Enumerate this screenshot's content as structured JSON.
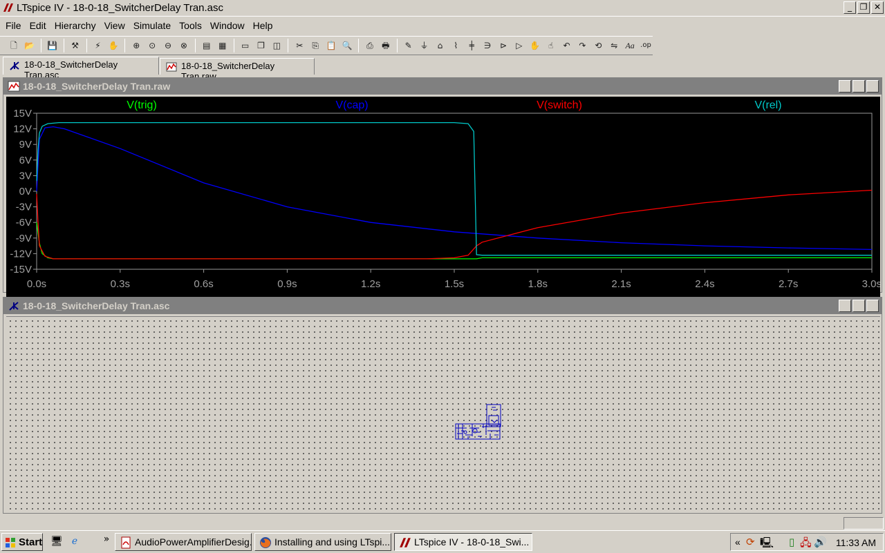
{
  "window": {
    "title": "LTspice IV - 18-0-18_SwitcherDelay Tran.asc"
  },
  "menu": [
    "File",
    "Edit",
    "Hierarchy",
    "View",
    "Simulate",
    "Tools",
    "Window",
    "Help"
  ],
  "toolbar_icons": [
    "new-schematic-icon",
    "open-icon",
    "save-icon",
    "control-panel-icon",
    "run-icon",
    "halt-icon",
    "zoom-in-icon",
    "pan-icon",
    "zoom-out-icon",
    "zoom-fit-icon",
    "autorange-icon",
    "grid-icon",
    "tile-horizontal-icon",
    "cascade-icon",
    "tile-vertical-icon",
    "cut-icon",
    "copy-icon",
    "paste-icon",
    "find-icon",
    "print-setup-icon",
    "print-icon",
    "draw-wire-icon",
    "ground-icon",
    "label-icon",
    "resistor-icon",
    "capacitor-icon",
    "inductor-icon",
    "diode-icon",
    "component-icon",
    "move-icon",
    "drag-icon",
    "undo-icon",
    "redo-icon",
    "rotate-icon",
    "mirror-icon",
    "text-icon",
    "spice-directive-icon"
  ],
  "tabs": [
    {
      "label": "18-0-18_SwitcherDelay Tran.asc",
      "active": true
    },
    {
      "label": "18-0-18_SwitcherDelay Tran.raw",
      "active": false
    }
  ],
  "waveform_window": {
    "title": "18-0-18_SwitcherDelay Tran.raw"
  },
  "schematic_window": {
    "title": "18-0-18_SwitcherDelay Tran.asc"
  },
  "chart_data": {
    "type": "line",
    "xlabel": "",
    "ylabel": "",
    "xlim": [
      0,
      3.0
    ],
    "ylim": [
      -15,
      15
    ],
    "x_ticks": [
      "0.0s",
      "0.3s",
      "0.6s",
      "0.9s",
      "1.2s",
      "1.5s",
      "1.8s",
      "2.1s",
      "2.4s",
      "2.7s",
      "3.0s"
    ],
    "y_ticks": [
      "15V",
      "12V",
      "9V",
      "6V",
      "3V",
      "0V",
      "-3V",
      "-6V",
      "-9V",
      "-12V",
      "-15V"
    ],
    "grid": false,
    "series": [
      {
        "name": "V(trig)",
        "color": "#00ff00",
        "x": [
          0,
          0.01,
          0.02,
          0.04,
          0.06,
          0.1,
          0.5,
          1.0,
          1.5,
          1.55,
          1.58,
          1.6,
          2.0,
          2.5,
          3.0
        ],
        "y": [
          -6,
          -10,
          -12,
          -12.8,
          -13,
          -13,
          -13,
          -13,
          -13,
          -13,
          -13,
          -12.8,
          -12.8,
          -12.8,
          -12.8
        ]
      },
      {
        "name": "V(cap)",
        "color": "#0000ff",
        "x": [
          0,
          0.01,
          0.03,
          0.06,
          0.1,
          0.3,
          0.6,
          0.9,
          1.2,
          1.5,
          1.8,
          2.1,
          2.4,
          2.7,
          3.0
        ],
        "y": [
          0,
          10,
          12.2,
          12.4,
          12,
          8.2,
          1.6,
          -3.0,
          -6.0,
          -7.8,
          -9.0,
          -9.9,
          -10.5,
          -10.9,
          -11.2
        ]
      },
      {
        "name": "V(switch)",
        "color": "#ff0000",
        "x": [
          0,
          0.005,
          0.01,
          0.03,
          0.06,
          0.1,
          0.5,
          1.0,
          1.4,
          1.5,
          1.55,
          1.58,
          1.6,
          1.8,
          2.1,
          2.4,
          2.7,
          3.0
        ],
        "y": [
          -0.5,
          -6,
          -10.5,
          -12.5,
          -13,
          -13,
          -13,
          -13,
          -13,
          -12.8,
          -12.3,
          -10.5,
          -9.8,
          -7.0,
          -4.2,
          -2.2,
          -0.7,
          0.2
        ]
      },
      {
        "name": "V(rel)",
        "color": "#00c8c8",
        "x": [
          0,
          0.005,
          0.01,
          0.02,
          0.04,
          0.08,
          0.5,
          1.0,
          1.5,
          1.55,
          1.57,
          1.58,
          1.6,
          2.0,
          2.5,
          3.0
        ],
        "y": [
          2,
          8,
          11.2,
          12.5,
          13,
          13.2,
          13.2,
          13.2,
          13.2,
          13.0,
          11.5,
          -12.2,
          -12.3,
          -12.3,
          -12.3,
          -12.3
        ]
      }
    ]
  },
  "taskbar": {
    "start_label": "Start",
    "tasks": [
      {
        "label": "AudioPowerAmplifierDesig...",
        "active": false
      },
      {
        "label": "Installing and using LTspi...",
        "active": false
      },
      {
        "label": "LTspice IV - 18-0-18_Swi...",
        "active": true
      }
    ],
    "overflow": "»",
    "tray_chevron": "«",
    "clock": "11:33 AM"
  }
}
